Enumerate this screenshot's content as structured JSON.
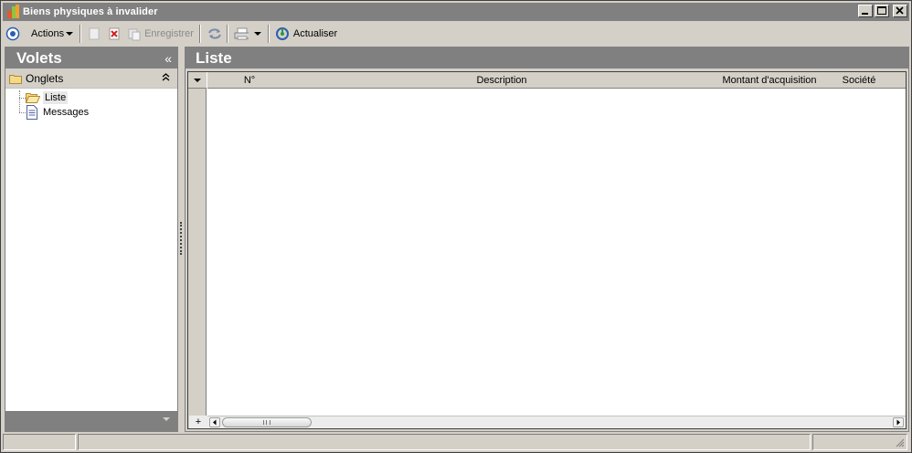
{
  "window": {
    "title": "Biens physiques à invalider"
  },
  "toolbar": {
    "actions_label": "Actions",
    "save_label": "Enregistrer",
    "refresh_label": "Actualiser"
  },
  "left_panel": {
    "title": "Volets",
    "collapse_glyph": "«",
    "group": {
      "label": "Onglets",
      "chevron": "⌃"
    },
    "tree_items": [
      {
        "label": "Liste",
        "icon": "open-folder-icon",
        "selected": true
      },
      {
        "label": "Messages",
        "icon": "document-icon",
        "selected": false
      }
    ]
  },
  "right_panel": {
    "title": "Liste",
    "columns": [
      "N°",
      "Description",
      "Montant d'acquisition",
      "Société"
    ],
    "rows": [],
    "add_glyph": "+"
  },
  "colors": {
    "chrome": "#d4d0c8",
    "header_gray": "#808080",
    "panel_bg": "#ffffff"
  }
}
